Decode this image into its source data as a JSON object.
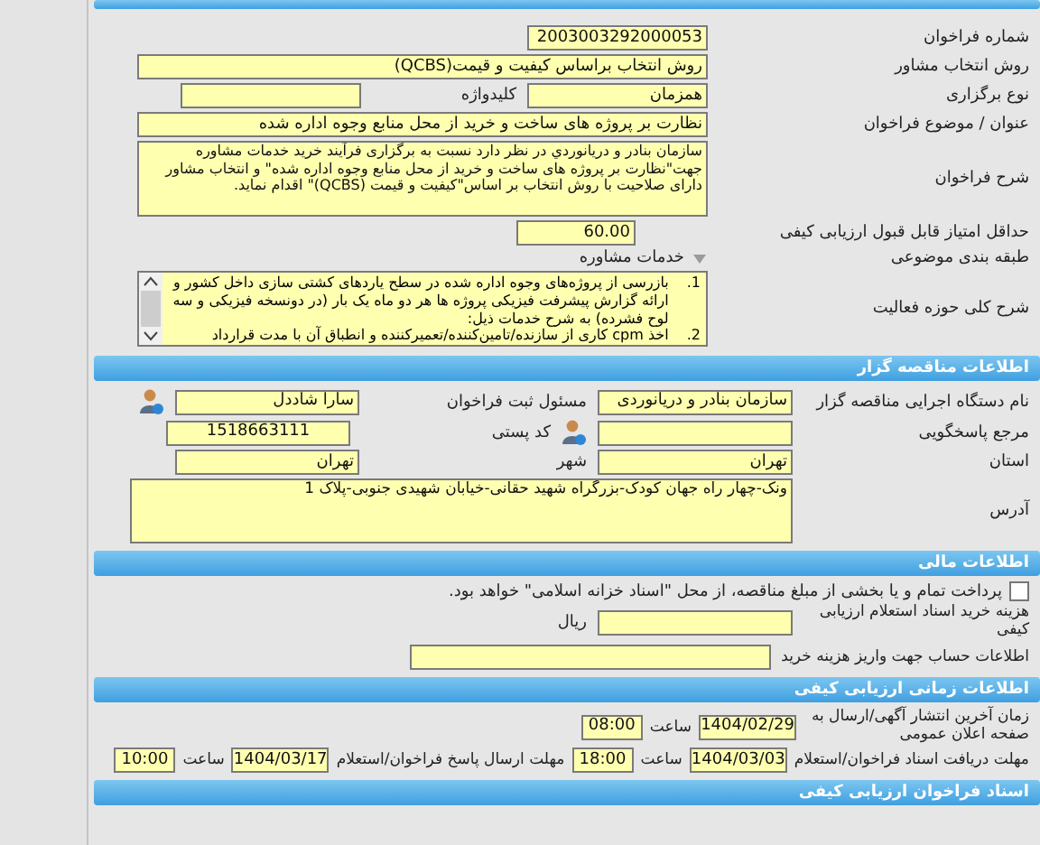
{
  "call_details": {
    "call_number": {
      "label": "شماره فراخوان",
      "value": "2003003292000053"
    },
    "selection_method": {
      "label": "روش انتخاب مشاور",
      "value": "روش انتخاب براساس کیفیت و قیمت(QCBS)"
    },
    "holding_type": {
      "label": "نوع برگزاری",
      "value": "همزمان"
    },
    "keyword": {
      "label": "کلیدواژه"
    },
    "subject": {
      "label": "عنوان / موضوع فراخوان",
      "value": "نظارت بر پروژه های ساخت و خرید از محل منابع وجوه اداره شده"
    },
    "description": {
      "label": "شرح فراخوان",
      "value": "سازمان بنادر و دریانوردي در نظر دارد نسبت به برگزاری فرآیند خرید خدمات مشاوره جهت\"نظارت بر پروژه های ساخت و خرید از محل منابع وجوه اداره شده\" و انتخاب مشاور دارای صلاحیت با روش انتخاب بر اساس\"کیفیت و قیمت (QCBS)\" اقدام نماید."
    },
    "min_score": {
      "label": "حداقل امتیاز قابل قبول ارزیابی کیفی",
      "value": "60.00"
    },
    "category": {
      "label": "طبقه بندی موضوعی",
      "value": "خدمات مشاوره"
    },
    "activity_scope": {
      "label": "شرح کلی حوزه فعالیت",
      "items": [
        {
          "number": "1.",
          "text": "بازرسی از پروژه‌های وجوه اداره شده در سطح یاردهای کشتی سازی داخل کشور و ارائه گزارش پیشرفت فیزیکی پروژه ها هر دو ماه یک بار (در دونسخه فیزیکی و سه لوح فشرده) به شرح خدمات ذیل:"
        },
        {
          "number": "2.",
          "text": "اخذ cpm کاری از سازنده/تامین‌کننده/تعمیرکننده و انطباق آن با مدت قرارداد"
        }
      ]
    }
  },
  "organizer": {
    "title": "اطلاعات مناقصه گزار",
    "agency": {
      "label": "نام دستگاه اجرایی مناقصه گزار",
      "value": "سازمان بنادر و دریانوردی"
    },
    "registrar": {
      "label": "مسئول ثبت فراخوان",
      "value": "سارا شاددل"
    },
    "responder": {
      "label": "مرجع پاسخگویی"
    },
    "postal_code": {
      "label": "کد پستی",
      "value": "1518663111"
    },
    "province": {
      "label": "استان",
      "value": "تهران"
    },
    "city": {
      "label": "شهر",
      "value": "تهران"
    },
    "address": {
      "label": "آدرس",
      "value": "ونک-چهار راه جهان کودک-بزرگراه شهید حقانی-خیابان شهیدی جنوبی-پلاک 1"
    }
  },
  "financial": {
    "title": "اطلاعات مالی",
    "treasury_payment": {
      "label": "پرداخت تمام و یا بخشی از مبلغ مناقصه، از محل \"اسناد خزانه اسلامی\" خواهد بود.",
      "checked": false
    },
    "document_fee": {
      "label": "هزینه خرید اسناد استعلام ارزیابی کیفی",
      "unit": "ریال"
    },
    "payment_account": {
      "label": "اطلاعات حساب جهت واریز هزینه خرید"
    }
  },
  "timing": {
    "title": "اطلاعات زمانی ارزیابی کیفی",
    "publish": {
      "label": "زمان آخرین انتشار آگهی/ارسال به صفحه اعلان عمومی",
      "date": "1404/02/29",
      "time_label": "ساعت",
      "time": "08:00"
    },
    "receive_deadline": {
      "label": "مهلت دریافت اسناد فراخوان/استعلام",
      "date": "1404/03/03",
      "time_label": "ساعت",
      "time": "18:00"
    },
    "submit_deadline": {
      "label": "مهلت ارسال پاسخ فراخوان/استعلام",
      "date": "1404/03/17",
      "time_label": "ساعت",
      "time": "10:00"
    }
  },
  "documents": {
    "title": "اسناد فراخوان ارزیابی کیفی"
  }
}
